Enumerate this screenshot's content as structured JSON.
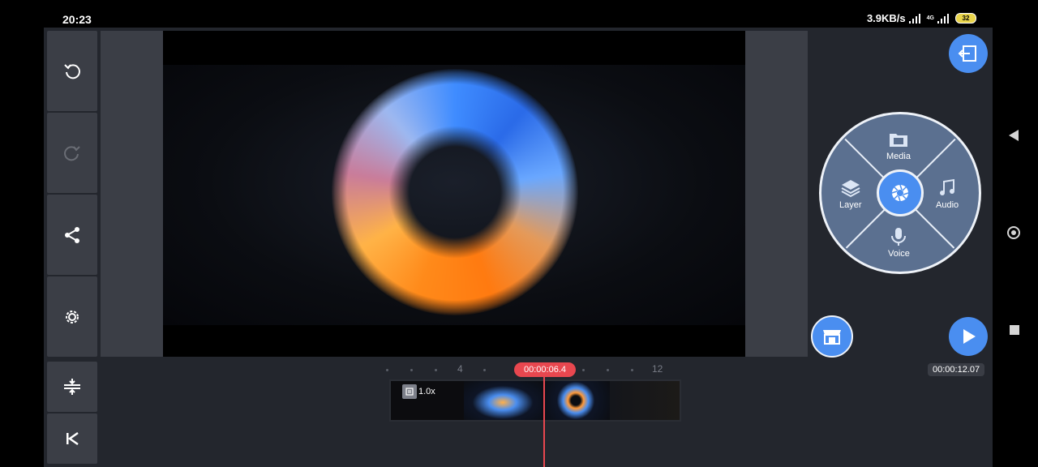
{
  "status_bar": {
    "time": "20:23",
    "net_speed": "3.9KB/s",
    "network_type": "4G",
    "battery": "32"
  },
  "left_toolbar": {
    "icons": [
      "undo-icon",
      "redo-icon",
      "share-icon",
      "settings-gear-icon"
    ],
    "redo_enabled": false
  },
  "timeline_tools": {
    "icons": [
      "timeline-adjust-icon",
      "skip-to-start-icon"
    ]
  },
  "media_wheel": {
    "center_icon": "camera-shutter-icon",
    "items": {
      "media": "Media",
      "audio": "Audio",
      "voice": "Voice",
      "layer": "Layer"
    }
  },
  "timeline": {
    "ruler_labels": [
      "4",
      "12"
    ],
    "current_time": "00:00:06.4",
    "total_time": "00:00:12.07",
    "clip_speed": "1.0x"
  },
  "colors": {
    "accent": "#4a8ef0",
    "playhead": "#e8474f",
    "panel": "#3b3e46",
    "background": "#23262d"
  }
}
